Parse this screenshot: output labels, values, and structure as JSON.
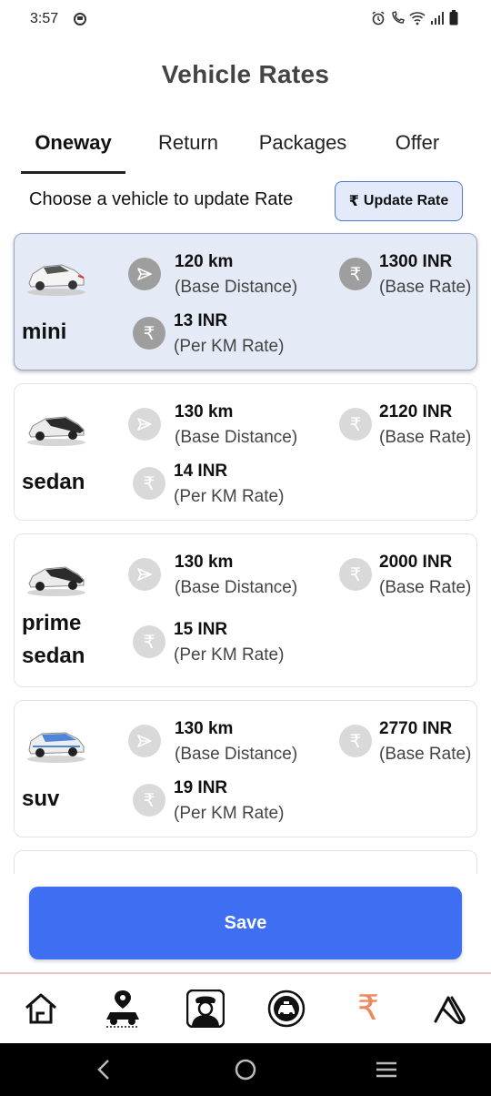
{
  "status": {
    "time": "3:57"
  },
  "app": {
    "title": "Vehicle Rates"
  },
  "tabs": [
    {
      "label": "Oneway",
      "active": true
    },
    {
      "label": "Return",
      "active": false
    },
    {
      "label": "Packages",
      "active": false
    },
    {
      "label": "Offer",
      "active": false
    }
  ],
  "hint": "Choose a vehicle to update Rate",
  "update_button": {
    "icon": "rupee-icon",
    "label": "Update Rate"
  },
  "vehicles": [
    {
      "name": "mini",
      "selected": true,
      "distance": "120 km",
      "distance_label": "(Base Distance)",
      "base_rate": "1300 INR",
      "base_rate_label": "(Base Rate)",
      "per_km": "13 INR",
      "per_km_label": "(Per KM Rate)",
      "car_color": "#f2f2f2",
      "car_roof": "#555555"
    },
    {
      "name": "sedan",
      "selected": false,
      "distance": "130 km",
      "distance_label": "(Base Distance)",
      "base_rate": "2120 INR",
      "base_rate_label": "(Base Rate)",
      "per_km": "14 INR",
      "per_km_label": "(Per KM Rate)",
      "car_color": "#e8e8e8",
      "car_roof": "#2b2b2b"
    },
    {
      "name_lines": [
        "prime",
        "sedan"
      ],
      "selected": false,
      "distance": "130 km",
      "distance_label": "(Base Distance)",
      "base_rate": "2000 INR",
      "base_rate_label": "(Base Rate)",
      "per_km": "15 INR",
      "per_km_label": "(Per KM Rate)",
      "car_color": "#e8e8e8",
      "car_roof": "#2b2b2b"
    },
    {
      "name": "suv",
      "selected": false,
      "distance": "130 km",
      "distance_label": "(Base Distance)",
      "base_rate": "2770 INR",
      "base_rate_label": "(Base Rate)",
      "per_km": "19 INR",
      "per_km_label": "(Per KM Rate)",
      "car_color": "#eaeaea",
      "car_roof": "#4f86d8"
    }
  ],
  "save_button": {
    "label": "Save"
  },
  "bottom_nav": [
    {
      "icon": "home-icon"
    },
    {
      "icon": "car-location-icon"
    },
    {
      "icon": "driver-icon"
    },
    {
      "icon": "taxi-badge-icon"
    },
    {
      "icon": "rupee-icon",
      "active": true,
      "color": "#f0885c"
    },
    {
      "icon": "app-logo-icon"
    }
  ],
  "colors": {
    "accent": "#3e6ff2",
    "selected_card": "#e5eaf7"
  }
}
